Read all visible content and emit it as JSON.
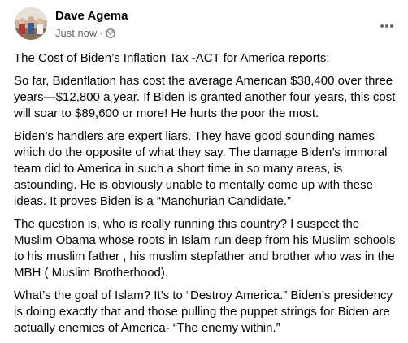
{
  "post": {
    "author": "Dave Agema",
    "timestamp": "Just now",
    "separator": "·",
    "privacy_icon": "globe-icon",
    "more_icon": "more-options-icon",
    "paragraphs": [
      "The Cost of Biden’s Inflation Tax -ACT for America reports:",
      "So far, Bidenflation has cost the average American $38,400 over three years—$12,800 a year. If Biden is granted another four years, this cost will soar to $89,600 or more! He hurts the poor the most.",
      "Biden’s handlers are expert liars.  They have good sounding names which do the opposite of what they say.  The damage Biden’s immoral team did to America in such a short time in so many areas, is astounding.  He is obviously unable to mentally come up with these ideas.  It proves Biden is a “Manchurian Candidate.”",
      "The question is, who is really running this country?  I suspect the Muslim Obama whose roots in Islam run deep from his Muslim schools to his muslim father , his muslim stepfather and brother who was in the MBH ( Muslim Brotherhood).",
      "What’s the goal of Islam?  It’s to “Destroy America.”  Biden’s presidency is doing exactly that and those pulling the puppet strings for Biden are actually enemies of America- “The enemy within.”"
    ]
  },
  "colors": {
    "text": "#050505",
    "secondary_text": "#65676b",
    "background": "#ffffff"
  }
}
